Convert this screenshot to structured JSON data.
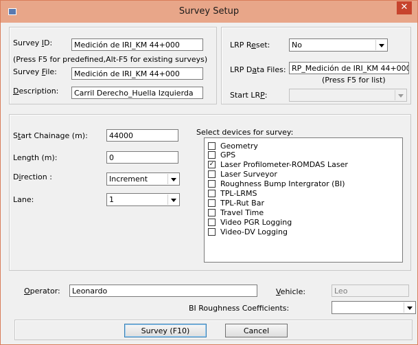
{
  "window": {
    "title": "Survey Setup",
    "close_glyph": "✕",
    "close_color": "#c7442d"
  },
  "survey": {
    "id_prefix": "Survey ",
    "id_key": "I",
    "id_suffix": "D:",
    "id_value": "Medición de IRI_KM 44+000",
    "hint": "(Press F5 for predefined,Alt-F5 for existing surveys)",
    "file_prefix": "Survey ",
    "file_key": "F",
    "file_suffix": "ile:",
    "file_value": "Medición de IRI_KM 44+000",
    "desc_key": "D",
    "desc_suffix": "escription:",
    "desc_value": "Carril Derecho_Huella Izquierda"
  },
  "lrp": {
    "reset_prefix": "LRP R",
    "reset_key": "e",
    "reset_suffix": "set:",
    "reset_value": "No",
    "data_prefix": "LRP D",
    "data_key": "a",
    "data_suffix": "ta Files:",
    "data_value": "RP_Medición de IRI_KM 44+000",
    "data_hint": "(Press F5 for list)",
    "start_prefix": "Start LR",
    "start_key": "P",
    "start_suffix": ":",
    "start_value": ""
  },
  "params": {
    "chainage_prefix": "S",
    "chainage_key": "t",
    "chainage_suffix": "art Chainage (m):",
    "chainage_value": "44000",
    "length_label": "Length (m):",
    "length_value": "0",
    "dir_prefix": "D",
    "dir_key": "i",
    "dir_suffix": "rection :",
    "dir_value": "Increment",
    "lane_label": "Lane:",
    "lane_value": "1"
  },
  "devices": {
    "label": "Select devices for survey:",
    "items": [
      {
        "name": "Geometry",
        "mark": ""
      },
      {
        "name": "GPS",
        "mark": ""
      },
      {
        "name": "Laser Profilometer-ROMDAS Laser",
        "mark": "✓"
      },
      {
        "name": "Laser Surveyor",
        "mark": ""
      },
      {
        "name": "Roughness Bump Intergrator (BI)",
        "mark": ""
      },
      {
        "name": "TPL-LRMS",
        "mark": ""
      },
      {
        "name": "TPL-Rut Bar",
        "mark": ""
      },
      {
        "name": "Travel Time",
        "mark": ""
      },
      {
        "name": "Video PGR Logging",
        "mark": ""
      },
      {
        "name": "Video-DV Logging",
        "mark": ""
      }
    ]
  },
  "bottom": {
    "operator_key": "O",
    "operator_suffix": "perator:",
    "operator_value": "Leonardo",
    "vehicle_key": "V",
    "vehicle_suffix": "ehicle:",
    "vehicle_value": "Leo",
    "bi_label": "BI Roughness Coefficients:",
    "bi_value": ""
  },
  "buttons": {
    "survey": "Survey (F10)",
    "cancel": "Cancel"
  }
}
